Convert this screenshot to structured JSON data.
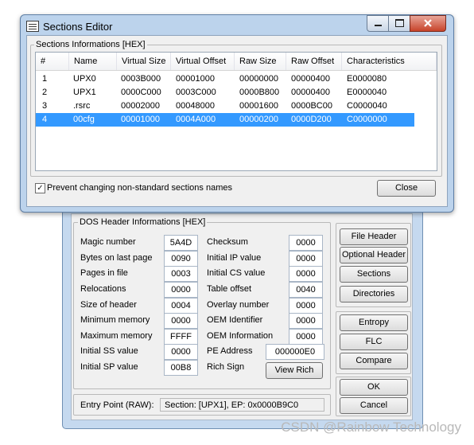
{
  "sections_editor": {
    "title": "Sections Editor",
    "group_title": "Sections Informations [HEX]",
    "columns": [
      "#",
      "Name",
      "Virtual Size",
      "Virtual Offset",
      "Raw Size",
      "Raw Offset",
      "Characteristics"
    ],
    "rows": [
      [
        "1",
        "UPX0",
        "0003B000",
        "00001000",
        "00000000",
        "00000400",
        "E0000080"
      ],
      [
        "2",
        "UPX1",
        "0000C000",
        "0003C000",
        "0000B800",
        "00000400",
        "E0000040"
      ],
      [
        "3",
        ".rsrc",
        "00002000",
        "00048000",
        "00001600",
        "0000BC00",
        "C0000040"
      ],
      [
        "4",
        "00cfg",
        "00001000",
        "0004A000",
        "00000200",
        "0000D200",
        "C0000000"
      ]
    ],
    "selected_row": 3,
    "checkbox_label": "Prevent changing non-standard sections names",
    "checkbox_mark": "✓",
    "close_label": "Close"
  },
  "dos": {
    "group_title": "DOS Header Informations [HEX]",
    "left": [
      {
        "label": "Magic number",
        "value": "5A4D"
      },
      {
        "label": "Bytes on last page",
        "value": "0090"
      },
      {
        "label": "Pages in file",
        "value": "0003"
      },
      {
        "label": "Relocations",
        "value": "0000"
      },
      {
        "label": "Size of header",
        "value": "0004"
      },
      {
        "label": "Minimum memory",
        "value": "0000"
      },
      {
        "label": "Maximum memory",
        "value": "FFFF"
      },
      {
        "label": "Initial SS value",
        "value": "0000"
      },
      {
        "label": "Initial SP value",
        "value": "00B8"
      }
    ],
    "right": [
      {
        "label": "Checksum",
        "value": "0000"
      },
      {
        "label": "Initial IP value",
        "value": "0000"
      },
      {
        "label": "Initial CS value",
        "value": "0000"
      },
      {
        "label": "Table offset",
        "value": "0040"
      },
      {
        "label": "Overlay number",
        "value": "0000"
      },
      {
        "label": "OEM Identifier",
        "value": "0000"
      },
      {
        "label": "OEM Information",
        "value": "0000"
      },
      {
        "label": "PE Address",
        "value": "000000E0"
      },
      {
        "label": "Rich Sign",
        "value": ""
      }
    ],
    "view_rich_label": "View Rich",
    "entry_label": "Entry Point (RAW):",
    "entry_value": "Section: [UPX1], EP: 0x0000B9C0"
  },
  "side_buttons": {
    "file_header": "File Header",
    "optional_header": "Optional Header",
    "sections": "Sections",
    "directories": "Directories",
    "entropy": "Entropy",
    "flc": "FLC",
    "compare": "Compare",
    "ok": "OK",
    "cancel": "Cancel"
  },
  "watermark": "CSDN @Rainbow Technology"
}
